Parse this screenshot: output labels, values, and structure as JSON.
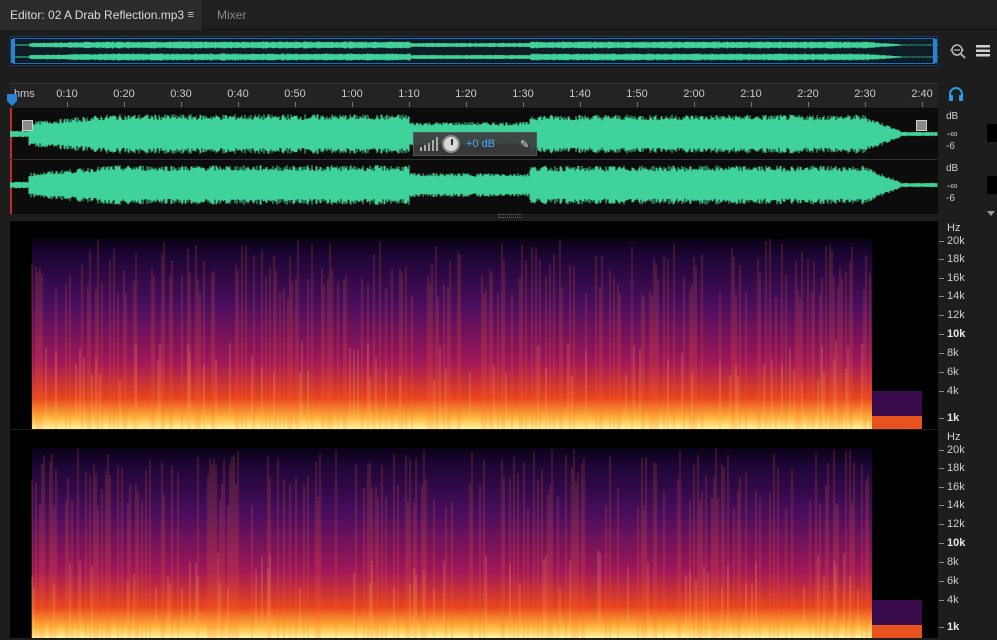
{
  "tabs": {
    "editor_label": "Editor: 02 A Drab Reflection.mp3",
    "editor_menu_glyph": "≡",
    "mixer_label": "Mixer"
  },
  "ruler": {
    "unit_label": "hms",
    "ticks": [
      "0:10",
      "0:20",
      "0:30",
      "0:40",
      "0:50",
      "1:00",
      "1:10",
      "1:20",
      "1:30",
      "1:40",
      "1:50",
      "2:00",
      "2:10",
      "2:20",
      "2:30",
      "2:40"
    ]
  },
  "hud": {
    "volume_value": "+0 dB",
    "pin_glyph": "✎"
  },
  "channel_scale": {
    "db_label": "dB",
    "inf_label": "-∞",
    "minus6_label": "-6"
  },
  "spectral_scale": {
    "unit": "Hz",
    "labels": [
      "20k",
      "18k",
      "16k",
      "14k",
      "12k",
      "10k",
      "8k",
      "6k",
      "4k",
      "1k"
    ]
  },
  "icons": {
    "zoom": "zoom-icon",
    "list": "list-icon",
    "headphones": "headphones-icon",
    "playhead": "playhead-marker-icon"
  },
  "colors": {
    "waveform": "#3fd29a",
    "accent": "#2a83d0",
    "background": "#1d1d1d"
  }
}
